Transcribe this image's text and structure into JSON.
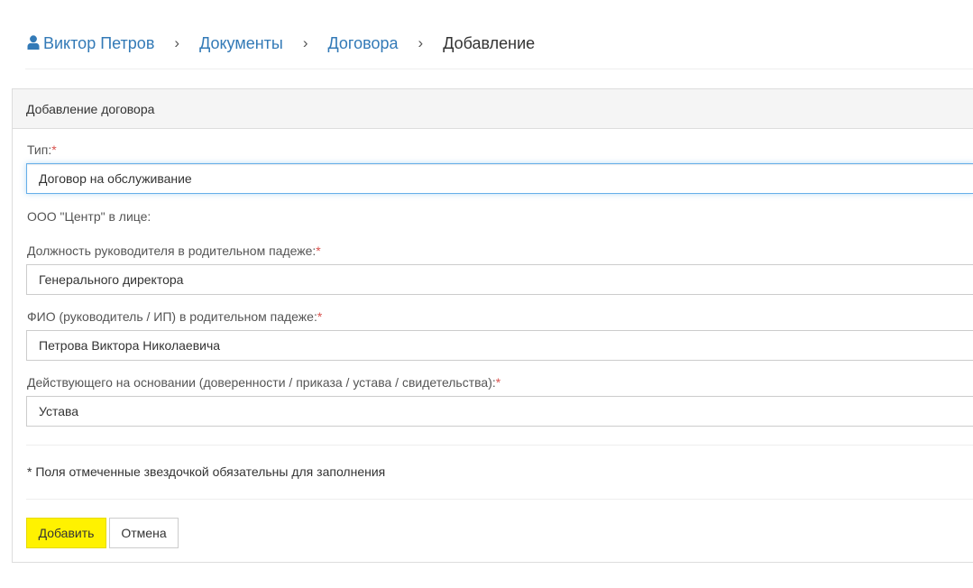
{
  "breadcrumb": {
    "user": "Виктор Петров",
    "documents": "Документы",
    "contracts": "Договора",
    "current": "Добавление",
    "separator": "›"
  },
  "panel": {
    "title": "Добавление договора"
  },
  "form": {
    "type_label": "Тип:",
    "type_value": "Договор на обслуживание",
    "company_text": "ООО \"Центр\" в лице:",
    "position_label": "Должность руководителя в родительном падеже:",
    "position_value": "Генерального директора",
    "fio_label": "ФИО (руководитель / ИП) в родительном падеже:",
    "fio_value": "Петрова Виктора Николаевича",
    "basis_label": "Действующего на основании (доверенности / приказа / устава / свидетельства):",
    "basis_value": "Устава",
    "required_mark": "*",
    "required_note": "* Поля отмеченные звездочкой обязательны для заполнения"
  },
  "buttons": {
    "add": "Добавить",
    "cancel": "Отмена"
  },
  "colors": {
    "link": "#337ab7",
    "required": "#d9534f",
    "primary_button": "#fff200"
  },
  "icons": {
    "user": "user-icon",
    "separator": "chevron-right-icon"
  }
}
